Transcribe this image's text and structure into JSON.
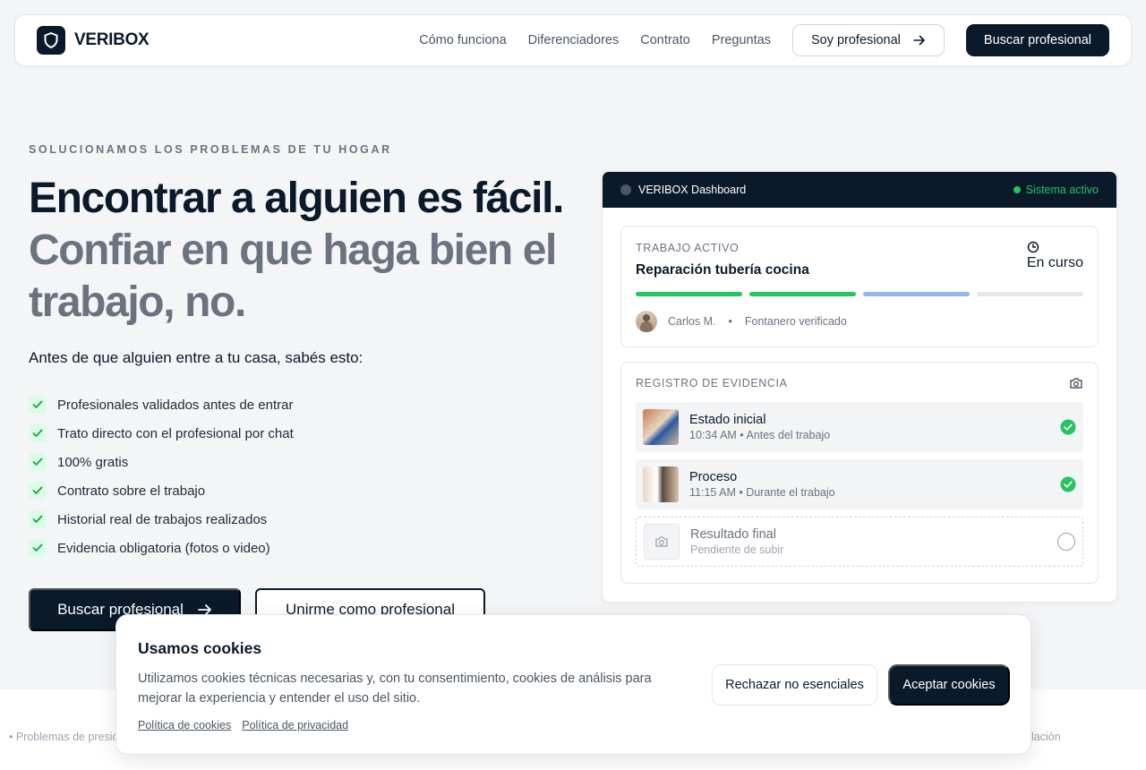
{
  "brand": {
    "name": "VERIBOX"
  },
  "nav": {
    "links": [
      "Cómo funciona",
      "Diferenciadores",
      "Contrato",
      "Preguntas"
    ],
    "pro_label": "Soy profesional",
    "search_label": "Buscar profesional"
  },
  "hero": {
    "eyebrow": "SOLUCIONAMOS LOS PROBLEMAS DE TU HOGAR",
    "title_line1": "Encontrar a alguien es fácil.",
    "title_line2": "Confiar en que haga bien el trabajo, no.",
    "lead": "Antes de que alguien entre a tu casa, sabés esto:",
    "checks": [
      "Profesionales validados antes de entrar",
      "Trato directo con el profesional por chat",
      "100% gratis",
      "Contrato sobre el trabajo",
      "Historial real de trabajos realizados",
      "Evidencia obligatoria (fotos o video)"
    ],
    "cta_primary": "Buscar profesional",
    "cta_secondary": "Unirme como profesional"
  },
  "dashboard": {
    "title": "VERIBOX Dashboard",
    "status": "Sistema activo",
    "job": {
      "label": "TRABAJO ACTIVO",
      "title": "Reparación tubería cocina",
      "state": "En curso",
      "progress": [
        "done",
        "done",
        "active",
        "pending"
      ],
      "worker": "Carlos M.",
      "worker_role": "Fontanero verificado"
    },
    "evidence": {
      "label": "REGISTRO DE EVIDENCIA",
      "items": [
        {
          "name": "Estado inicial",
          "meta": "10:34 AM • Antes del trabajo",
          "done": true
        },
        {
          "name": "Proceso",
          "meta": "11:15 AM • Durante el trabajo",
          "done": true
        },
        {
          "name": "Resultado final",
          "meta": "Pendiente de subir",
          "done": false
        }
      ]
    }
  },
  "band": {
    "left_text": "• Problemas de presió",
    "right_text": "lación"
  },
  "cookies": {
    "title": "Usamos cookies",
    "body": "Utilizamos cookies técnicas necesarias y, con tu consentimiento, cookies de análisis para mejorar la experiencia y entender el uso del sitio.",
    "link_cookies": "Política de cookies",
    "link_privacy": "Política de privacidad",
    "reject": "Rechazar no esenciales",
    "accept": "Aceptar cookies"
  },
  "colors": {
    "primary": "#0b1a2b",
    "success": "#22c55e",
    "progress_active": "#93b8f0",
    "progress_pending": "#e5e7eb"
  }
}
